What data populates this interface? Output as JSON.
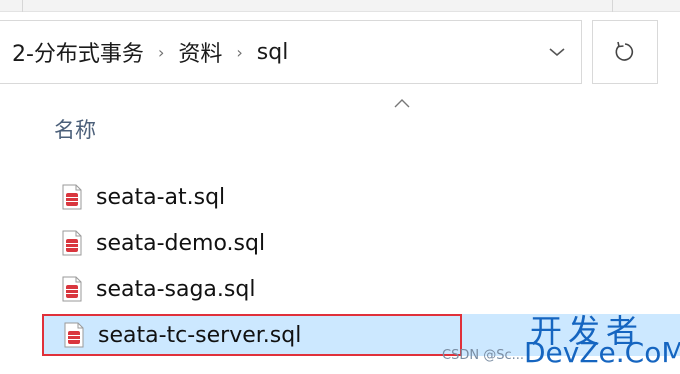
{
  "address_bar": {
    "breadcrumbs": [
      "2-分布式事务",
      "资料",
      "sql"
    ],
    "separator": "›"
  },
  "toolbar": {
    "dropdown_icon": "chevron-down-icon",
    "refresh_icon": "refresh-icon"
  },
  "file_list": {
    "column_header": "名称",
    "sort_indicator": "sort-ascending-icon",
    "files": [
      {
        "name": "seata-at.sql",
        "icon": "sql-file-icon",
        "selected": false
      },
      {
        "name": "seata-demo.sql",
        "icon": "sql-file-icon",
        "selected": false
      },
      {
        "name": "seata-saga.sql",
        "icon": "sql-file-icon",
        "selected": false
      },
      {
        "name": "seata-tc-server.sql",
        "icon": "sql-file-icon",
        "selected": true
      }
    ]
  },
  "watermark": {
    "brand_cn": "开发者",
    "brand_en": "DevZe.CoM",
    "csdn": "CSDN @Sc..."
  },
  "colors": {
    "selection_bg": "#cce8ff",
    "highlight_border": "#e0303a",
    "icon_red": "#d9363e",
    "watermark_blue": "#1565c0"
  }
}
